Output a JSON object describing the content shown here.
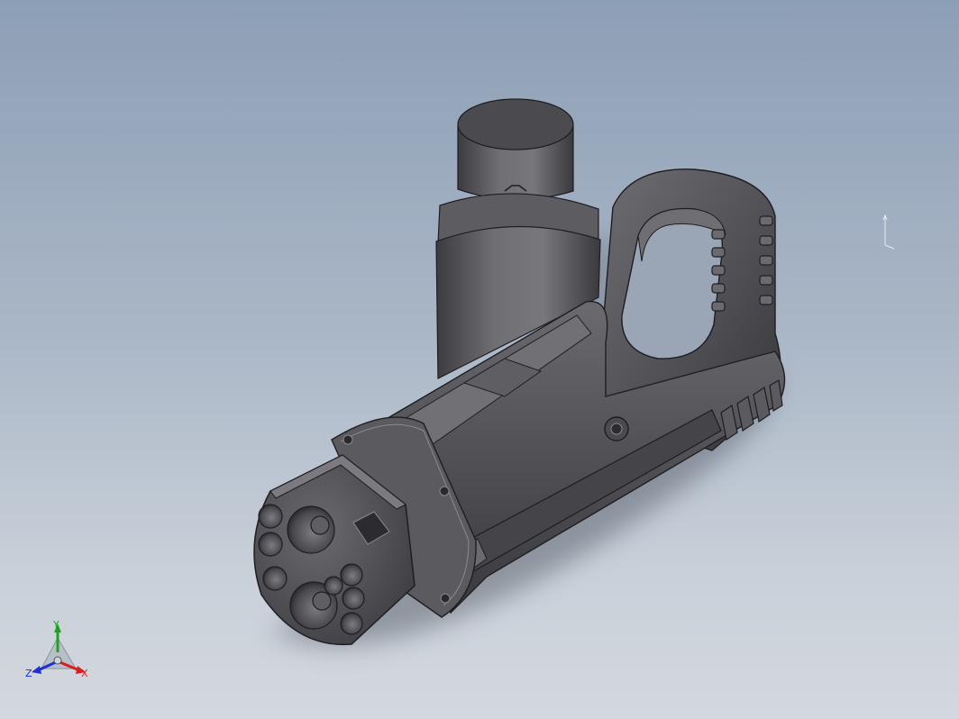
{
  "viewport": {
    "background_top": "#8d9fb6",
    "background_bottom": "#d3d8de"
  },
  "model": {
    "body_color": "#55555a",
    "highlight_color": "#7b7b80",
    "edge_color": "#1e1e22",
    "shadow_color": "#5d6570"
  },
  "triad": {
    "x_label": "X",
    "y_label": "Y",
    "z_label": "Z",
    "x_color": "#d81e1e",
    "y_color": "#1da31d",
    "z_color": "#1e2ed8"
  },
  "icons": {
    "small_triad": "mini-axis-icon",
    "view_triad": "reference-triad-icon"
  }
}
